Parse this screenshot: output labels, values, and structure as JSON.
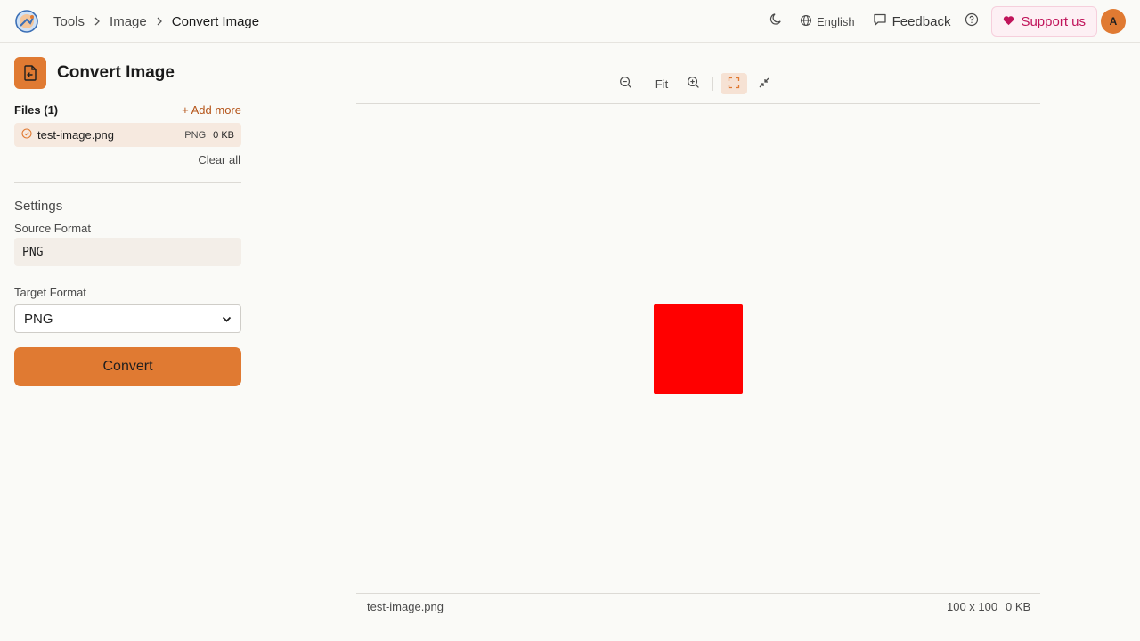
{
  "header": {
    "breadcrumbs": [
      "Tools",
      "Image",
      "Convert Image"
    ],
    "language": "English",
    "feedback_label": "Feedback",
    "support_label": "Support us",
    "avatar_initial": "A"
  },
  "sidebar": {
    "tool_title": "Convert Image",
    "files_label": "Files (1)",
    "add_more_label": "+ Add more",
    "file": {
      "name": "test-image.png",
      "format": "PNG",
      "size": "0 KB"
    },
    "clear_all_label": "Clear all",
    "settings_title": "Settings",
    "source_format_label": "Source Format",
    "source_format_value": "PNG",
    "target_format_label": "Target Format",
    "target_format_value": "PNG",
    "convert_label": "Convert"
  },
  "preview": {
    "fit_label": "Fit",
    "square_color": "#ff0000",
    "file_name": "test-image.png",
    "dimensions": "100 x 100",
    "size": "0 KB"
  },
  "colors": {
    "accent": "#e07a32",
    "support_text": "#c0145a",
    "background": "#fafaf7"
  }
}
